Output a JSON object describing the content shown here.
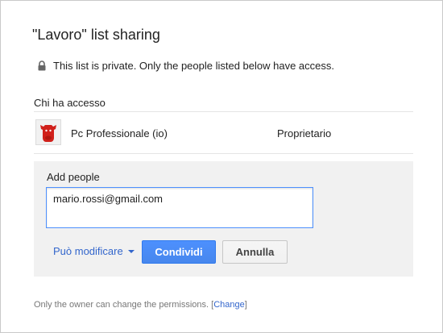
{
  "dialog": {
    "title": "\"Lavoro\" list sharing",
    "privacy_icon": "lock-icon",
    "privacy_text": "This list is private. Only the people listed below have access."
  },
  "access": {
    "label": "Chi ha accesso",
    "owner": {
      "avatar_icon": "cow-logo-icon",
      "name": "Pc Professionale (io)",
      "role": "Proprietario"
    }
  },
  "add_people": {
    "label": "Add people",
    "input_value": "mario.rossi@gmail.com",
    "permission": "Può modificare",
    "share_label": "Condividi",
    "cancel_label": "Annulla"
  },
  "footer": {
    "text": "Only the owner can change the permissions.",
    "bracket_open": "[",
    "change_link": "Change",
    "bracket_close": "]"
  },
  "colors": {
    "link": "#3366cc",
    "primary_button": "#4d90fe",
    "panel_bg": "#f1f1f1",
    "avatar_red": "#d0201a"
  }
}
